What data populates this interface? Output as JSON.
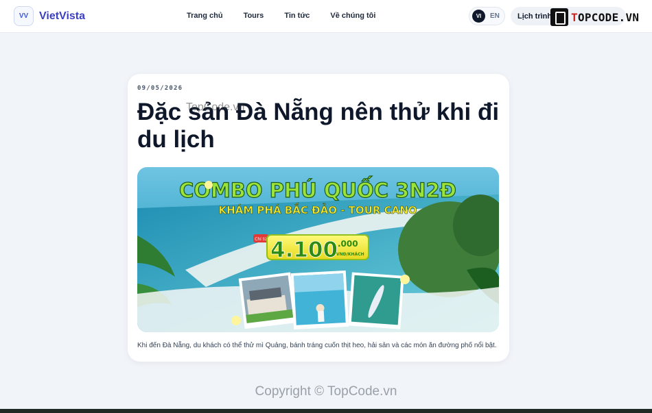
{
  "header": {
    "logo_mark": "VV",
    "logo_text": "VietVista",
    "nav": [
      "Trang chủ",
      "Tours",
      "Tin tức",
      "Về chúng tôi"
    ],
    "lang_active": "VI",
    "lang_other": "EN",
    "schedule_label": "Lịch trình"
  },
  "watermark": {
    "brand_a": "T",
    "brand_b": "OPCODE.VN",
    "title_overlay": "TopCode.vn",
    "copyright": "Copyright © TopCode.vn"
  },
  "article": {
    "date": "09/05/2026",
    "title": "Đặc sản Đà Nẵng nên thử khi đi du lịch",
    "excerpt": "Khi đến Đà Nẵng, du khách có thể thử mì Quảng, bánh tráng cuốn thịt heo, hải sản và các món ăn đường phố nổi bật."
  },
  "hero_banner": {
    "headline": "COMBO PHÚ QUỐC 3N2Đ",
    "subheadline": "KHÁM PHÁ BẮC ĐẢO - TOUR CANO",
    "from_label": "Chỉ từ",
    "price": "4.100",
    "price_small": ".000",
    "price_unit": "VNĐ/KHÁCH"
  },
  "colors": {
    "accent": "#3b3fc4",
    "headline_green": "#9be23a",
    "price_yellow": "#f2e830"
  }
}
